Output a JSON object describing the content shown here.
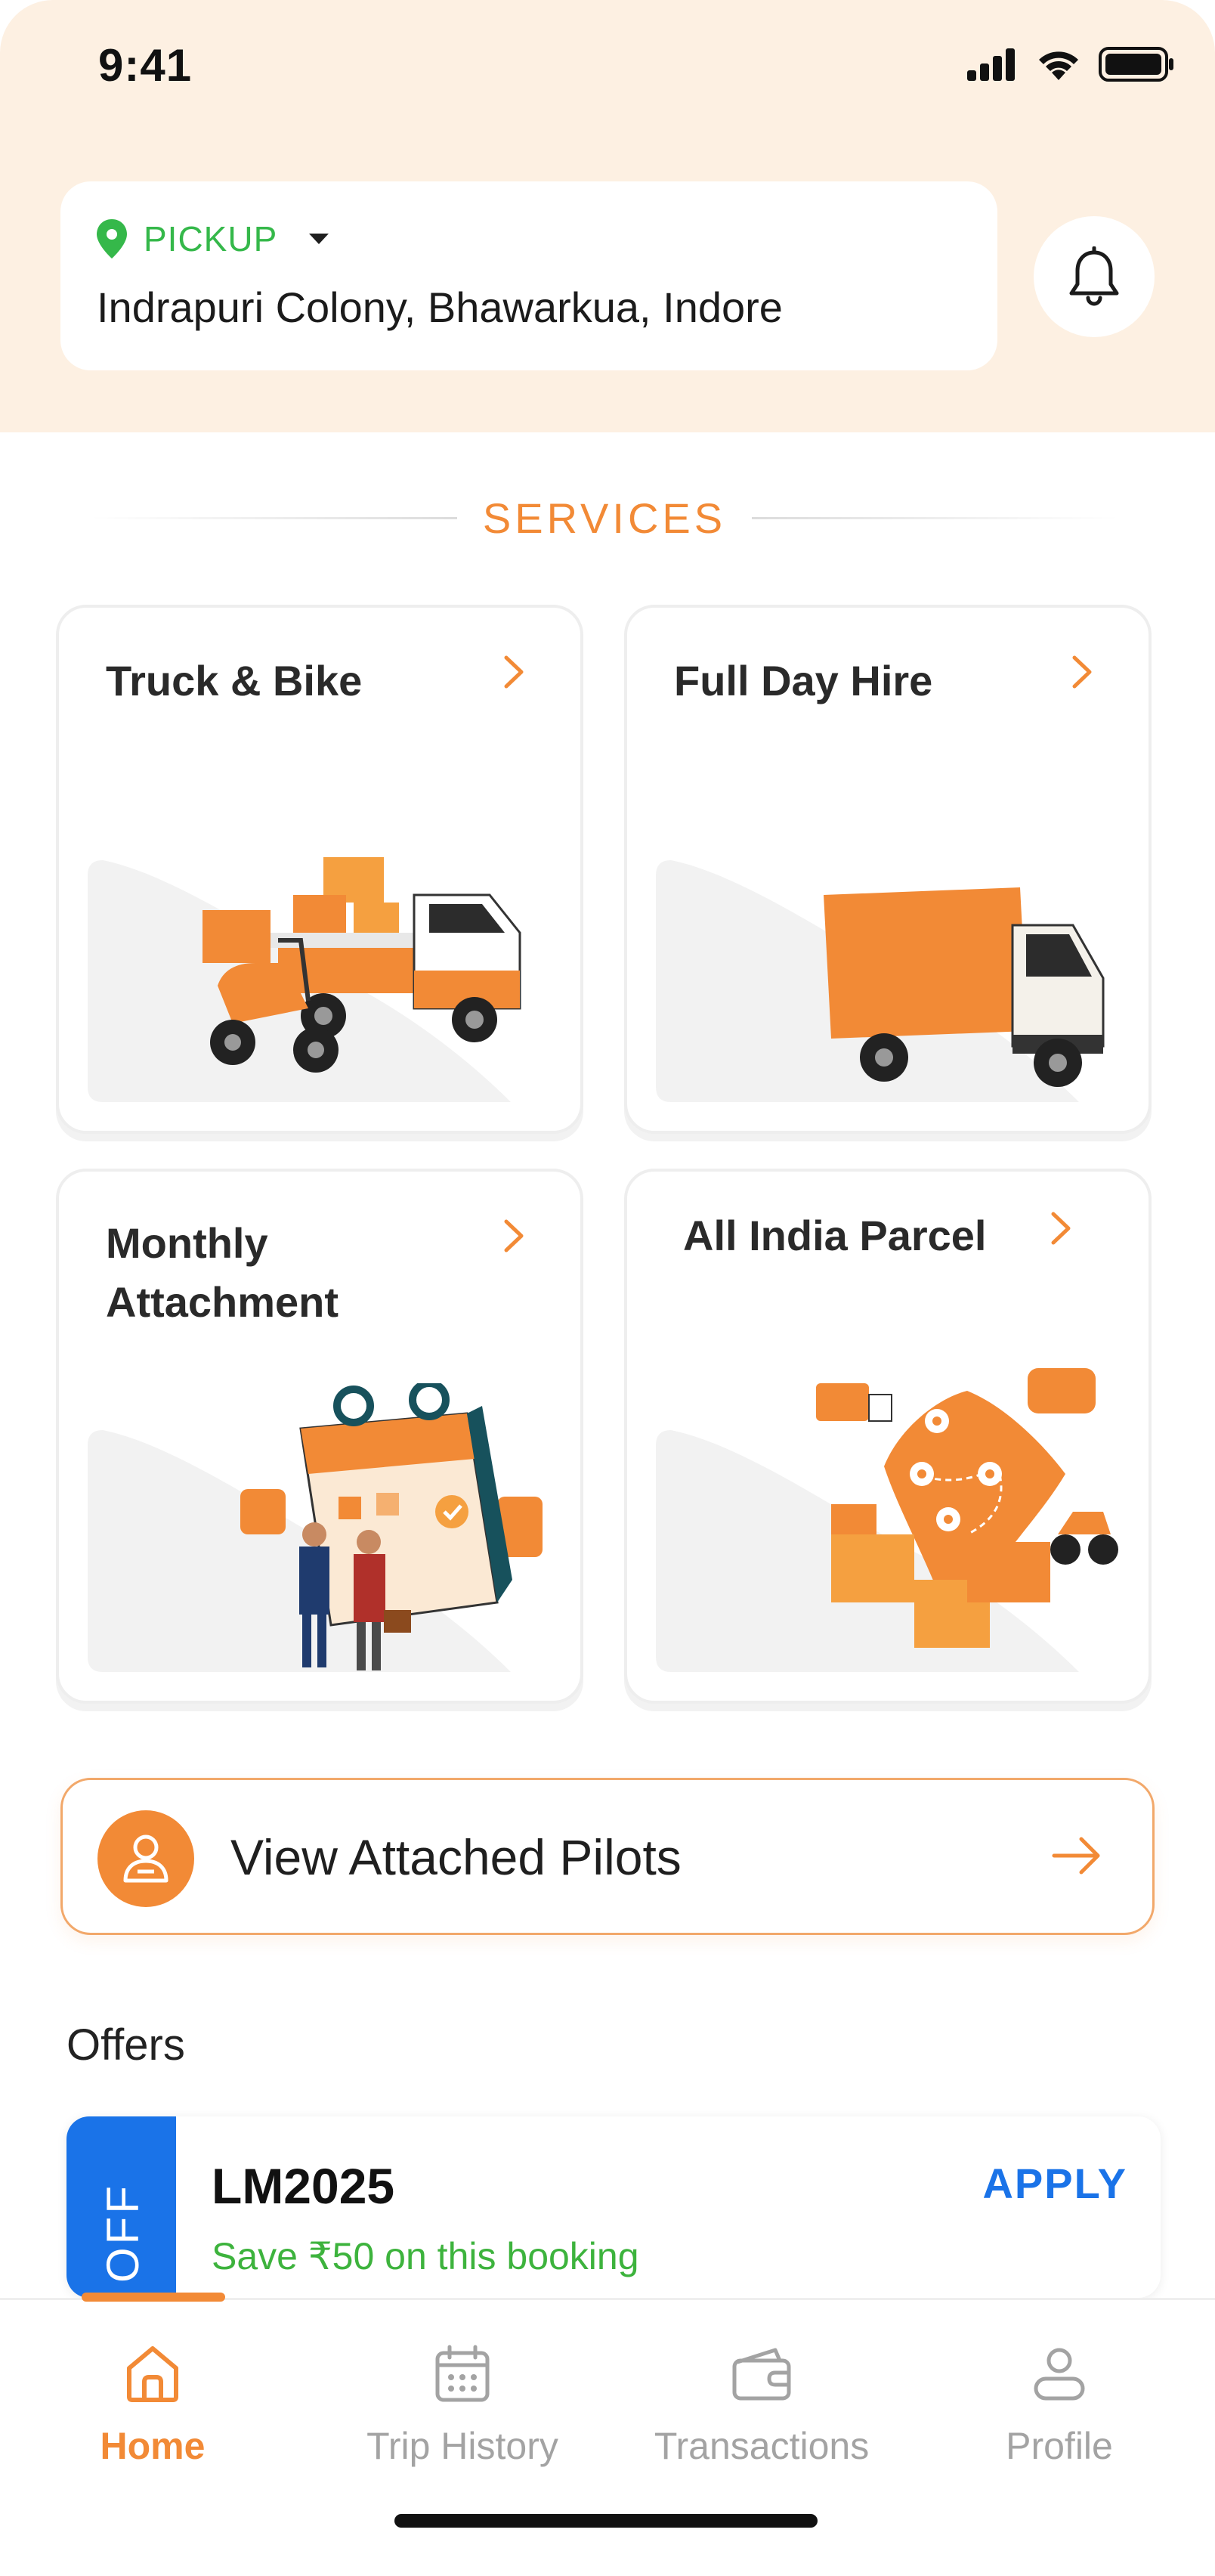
{
  "status_bar": {
    "time": "9:41"
  },
  "pickup": {
    "label": "PICKUP",
    "address": "Indrapuri Colony, Bhawarkua, Indore"
  },
  "services": {
    "title": "SERVICES",
    "cards": [
      {
        "title": "Truck & Bike"
      },
      {
        "title": "Full Day Hire"
      },
      {
        "title": "Monthly Attachment"
      },
      {
        "title": "All India Parcel"
      }
    ]
  },
  "pilots_button": {
    "label": "View Attached Pilots"
  },
  "offers": {
    "title": "Offers",
    "items": [
      {
        "tag": "OFF",
        "code": "LM2025",
        "description": "Save ₹50 on this booking",
        "action": "APPLY"
      }
    ]
  },
  "bottom_nav": {
    "items": [
      {
        "label": "Home",
        "active": true
      },
      {
        "label": "Trip History",
        "active": false
      },
      {
        "label": "Transactions",
        "active": false
      },
      {
        "label": "Profile",
        "active": false
      }
    ]
  },
  "colors": {
    "accent": "#f28a36",
    "header_bg": "#fdf0e2",
    "pickup_green": "#35b84a",
    "offer_blue": "#1a73e8",
    "offer_green": "#3db33d"
  },
  "icons": {
    "location": "map-pin-icon",
    "dropdown": "caret-down-icon",
    "notification": "bell-icon",
    "chevron": "chevron-right-icon",
    "pilot": "user-icon",
    "arrow": "arrow-right-icon",
    "home": "home-icon",
    "trip_history": "calendar-icon",
    "transactions": "wallet-icon",
    "profile": "profile-icon"
  }
}
